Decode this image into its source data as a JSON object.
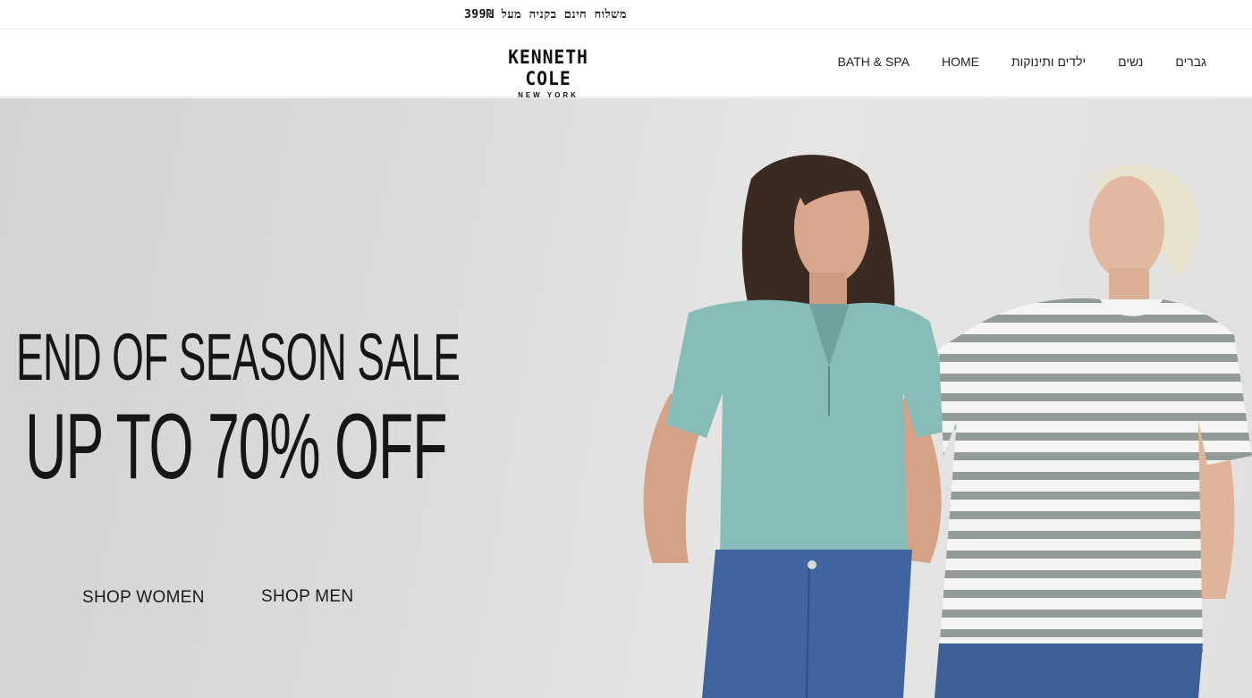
{
  "announcement": {
    "text": "משלוח חינם בקניה מעל 399₪"
  },
  "header": {
    "logo": {
      "brand": "KENNETH COLE",
      "sub": "NEW YORK"
    },
    "nav": [
      {
        "label": "גברים"
      },
      {
        "label": "נשים"
      },
      {
        "label": "ילדים ותינוקות"
      },
      {
        "label": "HOME"
      },
      {
        "label": "BATH & SPA"
      }
    ]
  },
  "hero": {
    "headline_1": "END OF SEASON SALE",
    "headline_2": "UP TO 70% OFF",
    "cta_women": "SHOP WOMEN",
    "cta_men": "SHOP MEN"
  },
  "colors": {
    "background": "#ffffff",
    "hero_bg": "#dcdcdb",
    "text": "#111111",
    "teal_shirt": "#88bcb8",
    "denim": "#3f64a0",
    "stripe": "#8f9a96"
  }
}
